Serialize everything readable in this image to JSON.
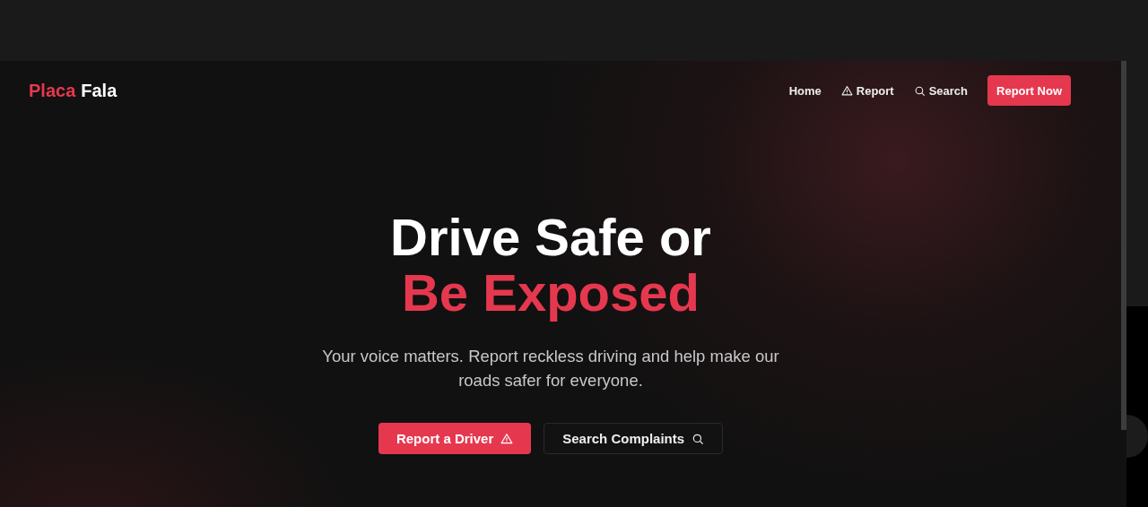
{
  "logo": {
    "first": "Placa",
    "second": "Fala"
  },
  "nav": [
    {
      "label": "Home",
      "kind": "plain"
    },
    {
      "label": "Report",
      "kind": "warning"
    },
    {
      "label": "Search",
      "kind": "search"
    }
  ],
  "nav_button": "Report Now",
  "hero": {
    "title_line1": "Drive Safe or",
    "title_line2": "Be Exposed",
    "subtitle": "Your voice matters. Report reckless driving and help make our roads safer for everyone."
  },
  "actions": [
    {
      "label": "Report a Driver",
      "kind": "primary"
    },
    {
      "label": "Search Complaints",
      "kind": "secondary"
    }
  ]
}
